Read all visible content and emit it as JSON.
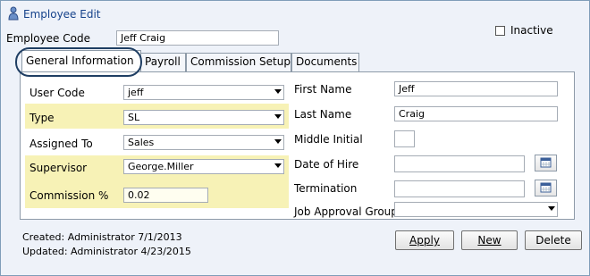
{
  "window": {
    "title": "Employee Edit",
    "icons": {
      "title": "user-icon",
      "calendar": "calendar-icon"
    }
  },
  "header": {
    "employee_code_label": "Employee Code",
    "employee_code_value": "Jeff Craig",
    "inactive_label": "Inactive",
    "inactive_checked": false
  },
  "tabs": [
    {
      "label": "General Information",
      "active": true
    },
    {
      "label": "Payroll"
    },
    {
      "label": "Commission Setup"
    },
    {
      "label": "Documents"
    }
  ],
  "general": {
    "user_code": {
      "label": "User Code",
      "value": "jeff"
    },
    "type": {
      "label": "Type",
      "value": "SL"
    },
    "assigned_to": {
      "label": "Assigned To",
      "value": "Sales"
    },
    "supervisor": {
      "label": "Supervisor",
      "value": "George.Miller"
    },
    "commission": {
      "label": "Commission %",
      "value": "0.02"
    },
    "first_name": {
      "label": "First Name",
      "value": "Jeff"
    },
    "last_name": {
      "label": "Last Name",
      "value": "Craig"
    },
    "middle_initial": {
      "label": "Middle Initial",
      "value": ""
    },
    "date_of_hire": {
      "label": "Date of Hire",
      "value": ""
    },
    "termination": {
      "label": "Termination",
      "value": ""
    },
    "job_approval_group": {
      "label": "Job Approval Group",
      "value": ""
    }
  },
  "footer": {
    "created": "Created: Administrator 7/1/2013",
    "updated": "Updated: Administrator 4/23/2015",
    "apply": "Apply",
    "new": "New",
    "delete": "Delete"
  },
  "colors": {
    "highlight": "#f7f2b6",
    "annotation_oval": "#1f3e63",
    "title_text": "#15428b"
  }
}
